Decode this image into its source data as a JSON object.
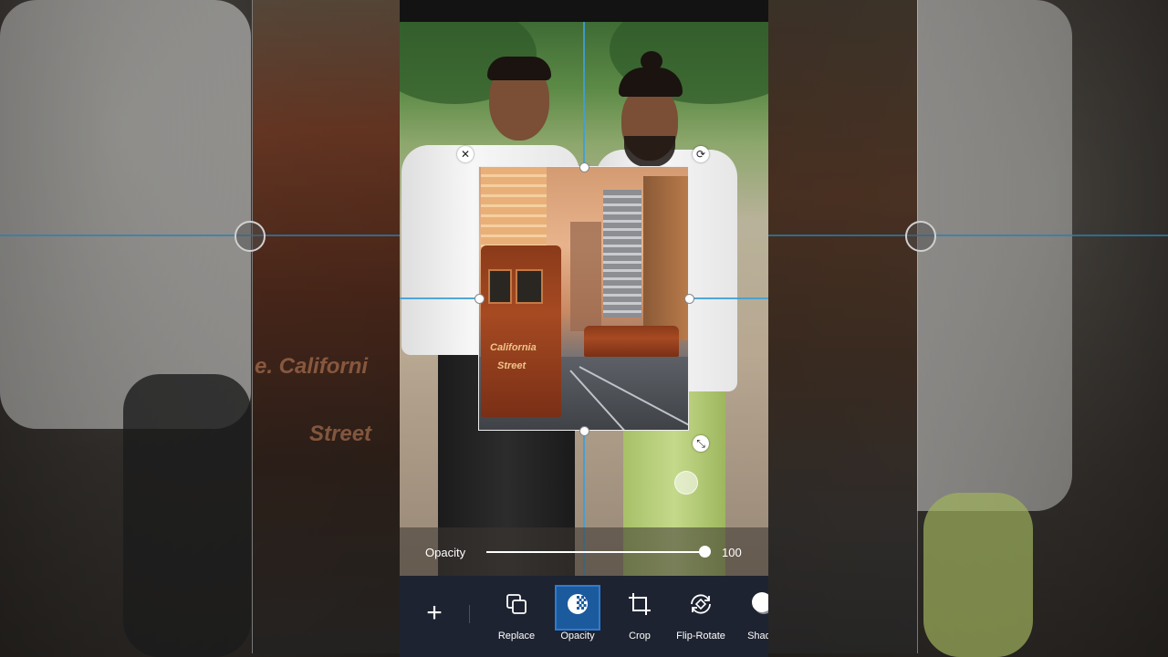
{
  "opacity_panel": {
    "label": "Opacity",
    "value": "100",
    "level": 1.0
  },
  "toolbar": {
    "add_icon": "plus-icon",
    "tools": [
      {
        "label": "Replace",
        "icon": "replace-icon"
      },
      {
        "label": "Opacity",
        "icon": "opacity-icon",
        "active": true
      },
      {
        "label": "Crop",
        "icon": "crop-icon"
      },
      {
        "label": "Flip-Rotate",
        "icon": "flip-rotate-icon"
      },
      {
        "label": "Shado",
        "icon": "shadow-icon"
      }
    ]
  },
  "overlay": {
    "sign_line1": "California",
    "sign_line2": "Street"
  },
  "backdrop": {
    "tram_line1": "e. Californi",
    "tram_line2": "Street"
  },
  "colors": {
    "guide": "#3f9fd6",
    "active_tool": "#1c5a9e",
    "toolbar_bg": "#1d2330"
  }
}
